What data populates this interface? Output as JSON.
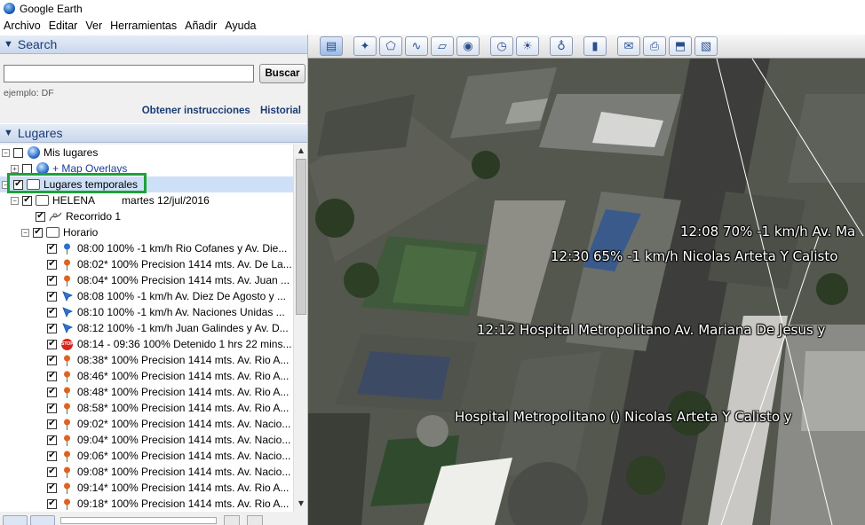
{
  "window": {
    "title": "Google Earth"
  },
  "menu": [
    "Archivo",
    "Editar",
    "Ver",
    "Herramientas",
    "Añadir",
    "Ayuda"
  ],
  "search": {
    "header": "Search",
    "input_value": "",
    "button": "Buscar",
    "example": "ejemplo: DF",
    "directions_link": "Obtener instrucciones",
    "history_link": "Historial"
  },
  "places": {
    "header": "Lugares",
    "my_places": "Mis lugares",
    "map_overlays": "+ Map Overlays",
    "temp_places": "Lugares temporales",
    "helena": "HELENA",
    "helena_date": "martes 12/jul/2016",
    "recorrido": "Recorrido 1",
    "horario": "Horario",
    "items": [
      {
        "icon": "blue-pin-icon",
        "text": "08:00  100% -1 km/h Rio Cofanes y Av. Die..."
      },
      {
        "icon": "orange-pin-icon",
        "text": "08:02* 100% Precision 1414 mts.  Av. De La..."
      },
      {
        "icon": "orange-pin-icon",
        "text": "08:04* 100% Precision 1414 mts.  Av. Juan ..."
      },
      {
        "icon": "blue-arrow-icon",
        "text": "08:08  100% -1 km/h Av. Diez De Agosto y ..."
      },
      {
        "icon": "blue-arrow-icon",
        "text": "08:10  100% -1 km/h Av. Naciones Unidas ..."
      },
      {
        "icon": "blue-arrow-icon",
        "text": "08:12  100% -1 km/h Juan Galindes y Av. D..."
      },
      {
        "icon": "stop-icon",
        "text": "08:14 - 09:36  100% Detenido 1 hrs 22 mins..."
      },
      {
        "icon": "orange-pin-icon",
        "text": "08:38* 100% Precision 1414 mts.  Av. Rio A..."
      },
      {
        "icon": "orange-pin-icon",
        "text": "08:46* 100% Precision 1414 mts.  Av. Rio A..."
      },
      {
        "icon": "orange-pin-icon",
        "text": "08:48* 100% Precision 1414 mts.  Av. Rio A..."
      },
      {
        "icon": "orange-pin-icon",
        "text": "08:58* 100% Precision 1414 mts.  Av. Rio A..."
      },
      {
        "icon": "orange-pin-icon",
        "text": "09:02* 100% Precision 1414 mts.  Av. Nacio..."
      },
      {
        "icon": "orange-pin-icon",
        "text": "09:04* 100% Precision 1414 mts.  Av. Nacio..."
      },
      {
        "icon": "orange-pin-icon",
        "text": "09:06* 100% Precision 1414 mts.  Av. Nacio..."
      },
      {
        "icon": "orange-pin-icon",
        "text": "09:08* 100% Precision 1414 mts.  Av. Nacio..."
      },
      {
        "icon": "orange-pin-icon",
        "text": "09:14* 100% Precision 1414 mts.  Av. Rio A..."
      },
      {
        "icon": "orange-pin-icon",
        "text": "09:18* 100% Precision 1414 mts.  Av. Rio A..."
      }
    ]
  },
  "toolbar": {
    "buttons": [
      "sidebar-toggle-icon",
      "placemark-icon",
      "polygon-icon",
      "path-icon",
      "overlay-icon",
      "tour-icon",
      "history-icon",
      "sunlight-icon",
      "planet-icon",
      "ruler-icon",
      "email-icon",
      "print-icon",
      "save-image-icon",
      "maps-icon"
    ]
  },
  "map_labels": [
    "12:08   70% -1 km/h Av. Ma",
    "12:30   65% -1 km/h Nicolas Arteta Y Calisto",
    "12:12 Hospital Metropolitano Av. Mariana De Jesus y",
    "Hospital Metropolitano ()  Nicolas Arteta Y Calisto y"
  ],
  "colors": {
    "highlight": "#1fa13a",
    "selection": "#cde0f7",
    "header_text": "#1a3c75"
  }
}
